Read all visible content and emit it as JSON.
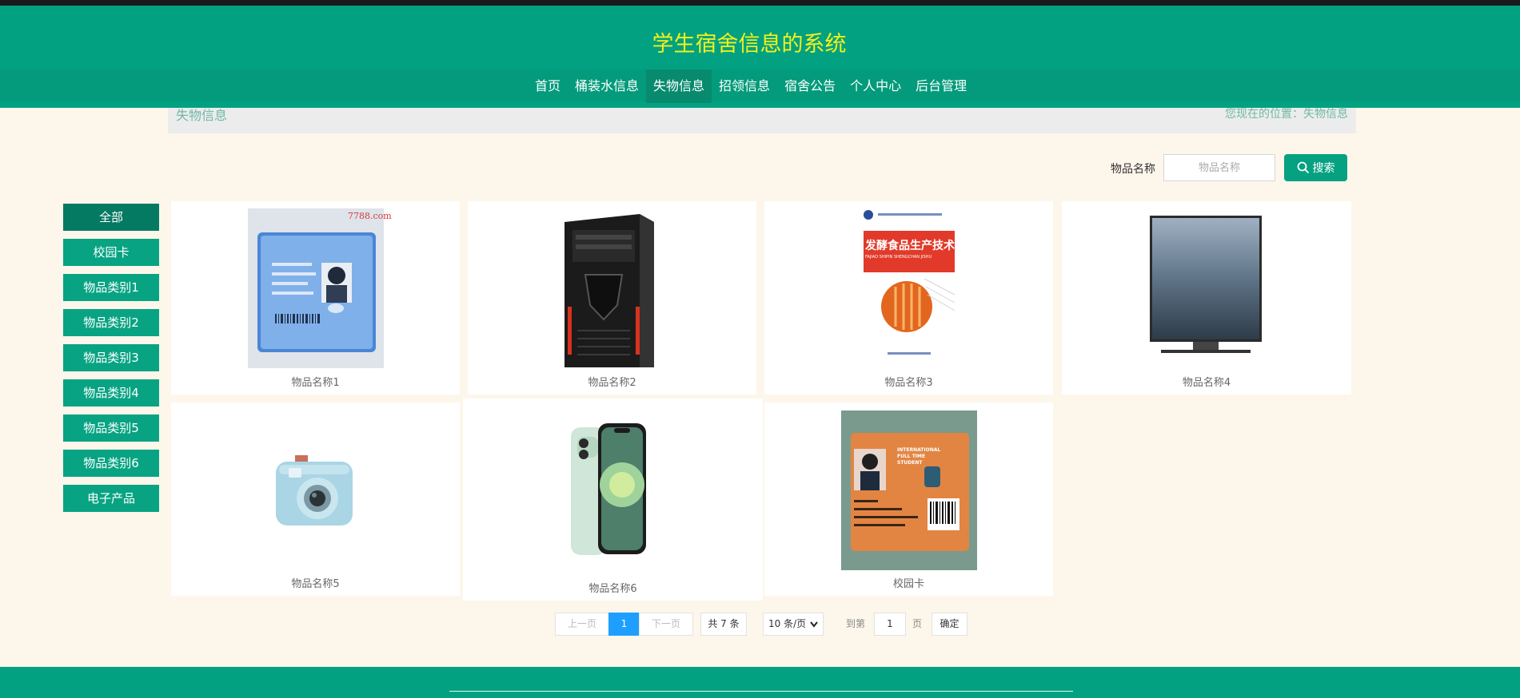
{
  "header": {
    "title": "学生宿舍信息的系统"
  },
  "nav": [
    {
      "label": "首页"
    },
    {
      "label": "桶装水信息"
    },
    {
      "label": "失物信息"
    },
    {
      "label": "招领信息"
    },
    {
      "label": "宿舍公告"
    },
    {
      "label": "个人中心"
    },
    {
      "label": "后台管理"
    }
  ],
  "nav_active": "失物信息",
  "breadcrumb": {
    "title": "失物信息",
    "location": "您现在的位置：失物信息"
  },
  "search": {
    "label": "物品名称",
    "placeholder": "物品名称",
    "button": "搜索"
  },
  "categories": [
    {
      "label": "全部"
    },
    {
      "label": "校园卡"
    },
    {
      "label": "物品类别1"
    },
    {
      "label": "物品类别2"
    },
    {
      "label": "物品类别3"
    },
    {
      "label": "物品类别4"
    },
    {
      "label": "物品类别5"
    },
    {
      "label": "物品类别6"
    },
    {
      "label": "电子产品"
    }
  ],
  "items": [
    {
      "name": "物品名称1",
      "image": "student id card photo",
      "watermark": "7788.com"
    },
    {
      "name": "物品名称2",
      "image": "black computer tower case"
    },
    {
      "name": "物品名称3",
      "image": "book cover",
      "cover_title": "发酵食品生产技术",
      "cover_subtitle": "FAJIAO SHIPIN SHENGCHAN JISHU"
    },
    {
      "name": "物品名称4",
      "image": "flat screen tv"
    },
    {
      "name": "物品名称5",
      "image": "light blue instant camera"
    },
    {
      "name": "物品名称6",
      "image": "green smartphone"
    },
    {
      "name": "校园卡",
      "image": "international student card",
      "card_header": "INTERNATIONAL FULL TIME STUDENT"
    }
  ],
  "pagination": {
    "prev": "上一页",
    "current": "1",
    "next": "下一页",
    "total": "共 7 条",
    "page_size": "10 条/页",
    "goto_label": "到第",
    "goto_value": "1",
    "page_unit": "页",
    "confirm": "确定"
  },
  "colors": {
    "primary": "#02a181",
    "title": "#f3f11a",
    "background": "#fdf6ea",
    "pager_active": "#1e9fff"
  }
}
